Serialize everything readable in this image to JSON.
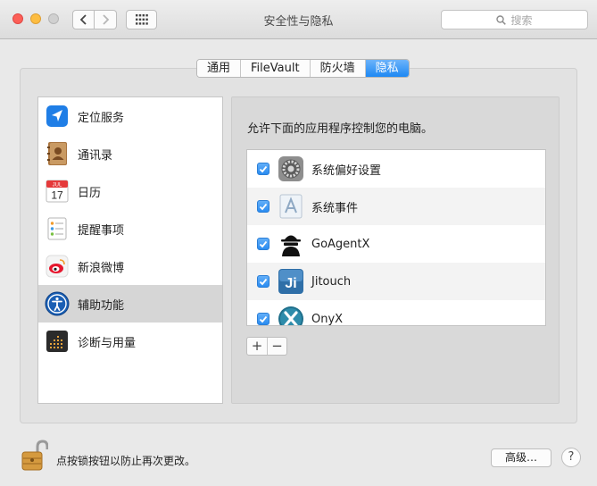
{
  "window": {
    "title": "安全性与隐私"
  },
  "search": {
    "placeholder": "搜索"
  },
  "tabs": [
    {
      "label": "通用",
      "active": false
    },
    {
      "label": "FileVault",
      "active": false
    },
    {
      "label": "防火墙",
      "active": false
    },
    {
      "label": "隐私",
      "active": true
    }
  ],
  "sidebar": {
    "items": [
      {
        "label": "定位服务",
        "icon": "location-arrow-icon"
      },
      {
        "label": "通讯录",
        "icon": "contacts-book-icon"
      },
      {
        "label": "日历",
        "icon": "calendar-icon",
        "icon_month": "JUL",
        "icon_day": "17"
      },
      {
        "label": "提醒事项",
        "icon": "reminders-list-icon"
      },
      {
        "label": "新浪微博",
        "icon": "weibo-icon"
      },
      {
        "label": "辅助功能",
        "icon": "accessibility-icon",
        "selected": true
      },
      {
        "label": "诊断与用量",
        "icon": "diagnostics-icon"
      }
    ]
  },
  "main": {
    "prompt": "允许下面的应用程序控制您的电脑。",
    "apps": [
      {
        "label": "系统偏好设置",
        "icon": "system-preferences-icon",
        "checked": true
      },
      {
        "label": "系统事件",
        "icon": "system-events-icon",
        "checked": true
      },
      {
        "label": "GoAgentX",
        "icon": "goagentx-spy-icon",
        "checked": true
      },
      {
        "label": "Jitouch",
        "icon": "jitouch-icon",
        "icon_text": "Ji",
        "checked": true
      },
      {
        "label": "OnyX",
        "icon": "onyx-icon",
        "checked": true
      }
    ],
    "add_label": "+",
    "remove_label": "−"
  },
  "footer": {
    "lock_text": "点按锁按钮以防止再次更改。",
    "advanced_label": "高级…",
    "help_label": "?"
  },
  "colors": {
    "accent": "#1e88f3",
    "checkbox": "#3b95f3"
  }
}
